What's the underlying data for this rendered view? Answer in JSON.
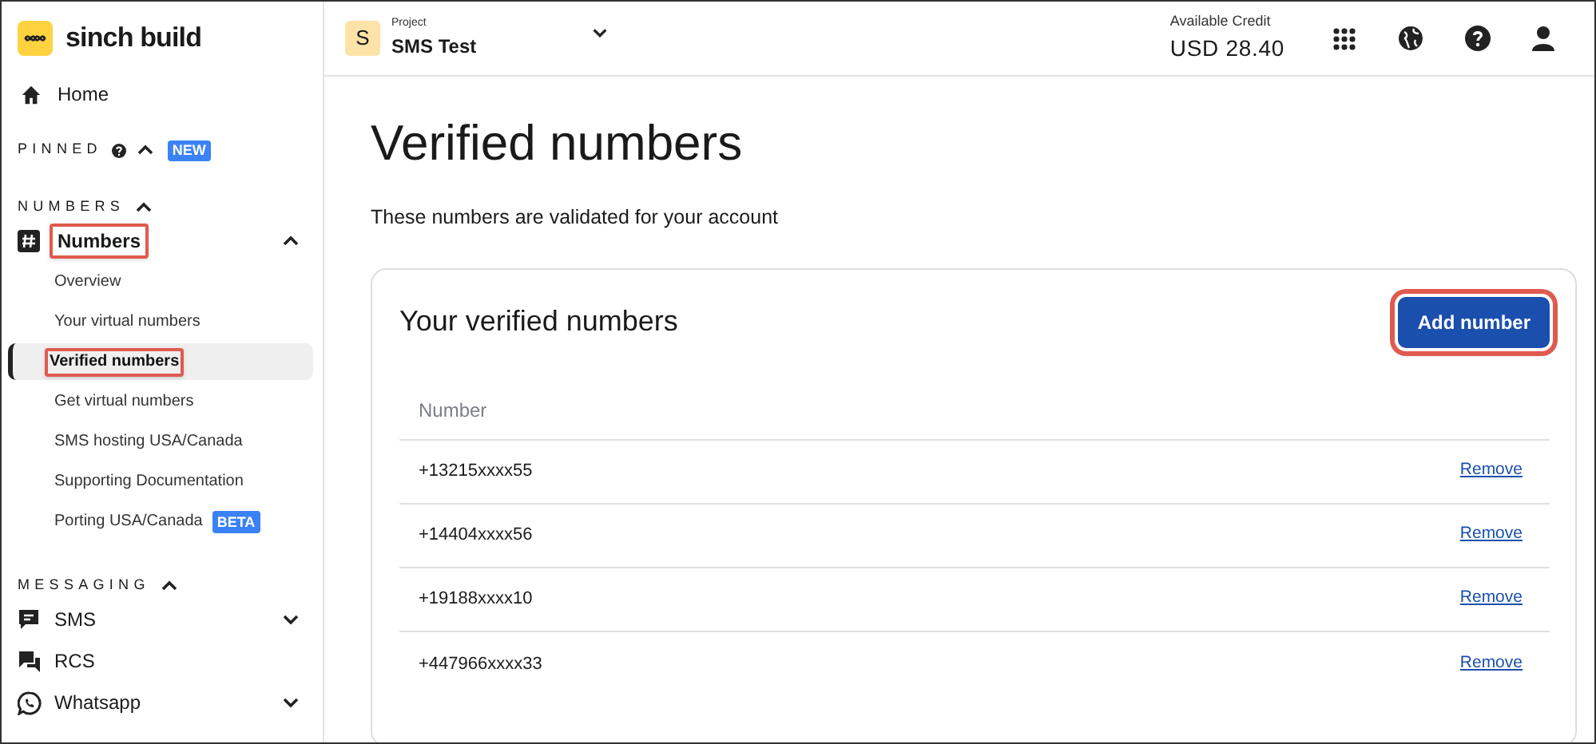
{
  "brand": {
    "name": "sinch build"
  },
  "topbar": {
    "project_avatar": "S",
    "project_label": "Project",
    "project_name": "SMS Test",
    "credit_label": "Available Credit",
    "credit_value": "USD 28.40"
  },
  "sidebar": {
    "home": {
      "label": "Home"
    },
    "sections": [
      {
        "title": "PINNED",
        "help": true,
        "expanded": true,
        "badge": "NEW"
      },
      {
        "title": "NUMBERS",
        "help": false,
        "expanded": true,
        "items": [
          {
            "label": "Numbers",
            "kind": "hash",
            "expanded": true,
            "highlighted": true,
            "children": [
              {
                "label": "Overview",
                "selected": false,
                "highlighted": false
              },
              {
                "label": "Your virtual numbers",
                "selected": false,
                "highlighted": false
              },
              {
                "label": "Verified numbers",
                "selected": true,
                "highlighted": true
              },
              {
                "label": "Get virtual numbers",
                "selected": false,
                "highlighted": false
              },
              {
                "label": "SMS hosting USA/Canada",
                "selected": false,
                "highlighted": false
              },
              {
                "label": "Supporting Documentation",
                "selected": false,
                "highlighted": false
              },
              {
                "label": "Porting USA/Canada",
                "selected": false,
                "highlighted": false,
                "badge": "BETA"
              }
            ]
          }
        ]
      },
      {
        "title": "MESSAGING",
        "help": false,
        "expanded": true,
        "items": [
          {
            "label": "SMS",
            "kind": "sms",
            "expanded": false,
            "highlighted": false
          },
          {
            "label": "RCS",
            "kind": "rcs",
            "highlighted": false
          },
          {
            "label": "Whatsapp",
            "kind": "whatsapp",
            "expanded": false,
            "highlighted": false
          }
        ]
      }
    ]
  },
  "page": {
    "title": "Verified numbers",
    "subtitle": "These numbers are validated for your account"
  },
  "card": {
    "title": "Your verified numbers",
    "add_button": {
      "label": "Add number",
      "highlighted": true
    },
    "table": {
      "columns": [
        "Number"
      ],
      "rows": [
        {
          "number": "+13215xxxx55",
          "action": "Remove"
        },
        {
          "number": "+14404xxxx56",
          "action": "Remove"
        },
        {
          "number": "+19188xxxx10",
          "action": "Remove"
        },
        {
          "number": "+447966xxxx33",
          "action": "Remove"
        }
      ]
    }
  }
}
